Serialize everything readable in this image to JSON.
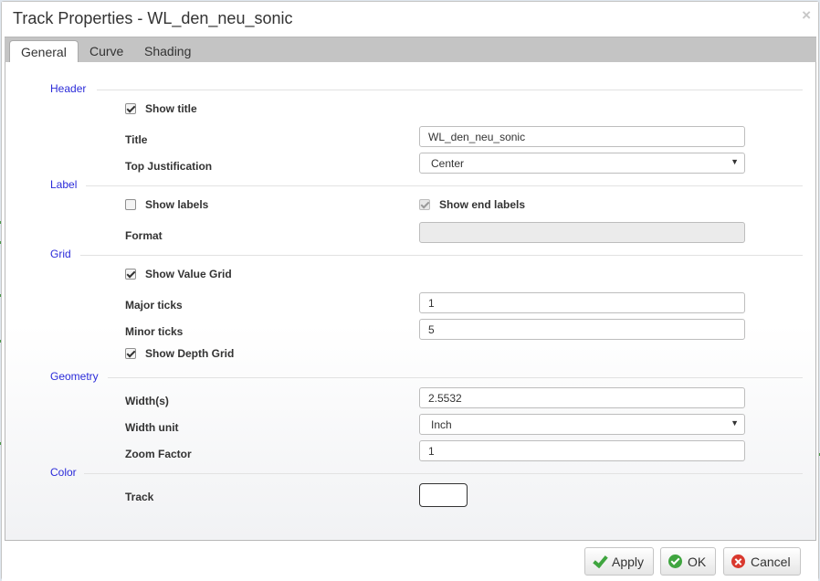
{
  "dialog": {
    "title": "Track Properties - WL_den_neu_sonic",
    "close_glyph": "×"
  },
  "tabs": [
    {
      "label": "General",
      "active": true
    },
    {
      "label": "Curve",
      "active": false
    },
    {
      "label": "Shading",
      "active": false
    }
  ],
  "sections": {
    "header": {
      "label": "Header",
      "show_title": {
        "label": "Show title",
        "checked": true
      },
      "title": {
        "label": "Title",
        "value": "WL_den_neu_sonic"
      },
      "top_justification": {
        "label": "Top Justification",
        "value": "Center"
      }
    },
    "label": {
      "label": "Label",
      "show_labels": {
        "label": "Show labels",
        "checked": false
      },
      "show_end_labels": {
        "label": "Show end labels",
        "checked": true,
        "disabled": true
      },
      "format": {
        "label": "Format",
        "value": ""
      }
    },
    "grid": {
      "label": "Grid",
      "show_value_grid": {
        "label": "Show Value Grid",
        "checked": true
      },
      "major_ticks": {
        "label": "Major ticks",
        "value": "1"
      },
      "minor_ticks": {
        "label": "Minor ticks",
        "value": "5"
      },
      "show_depth_grid": {
        "label": "Show Depth Grid",
        "checked": true
      }
    },
    "geometry": {
      "label": "Geometry",
      "widths": {
        "label": "Width(s)",
        "value": "2.5532"
      },
      "width_unit": {
        "label": "Width unit",
        "value": "Inch"
      },
      "zoom_factor": {
        "label": "Zoom Factor",
        "value": "1"
      }
    },
    "color": {
      "label": "Color",
      "track": {
        "label": "Track",
        "value": "#ffffff"
      }
    }
  },
  "footer": {
    "apply_label": "Apply",
    "ok_label": "OK",
    "cancel_label": "Cancel"
  },
  "colors": {
    "section_label": "#2b2bd9",
    "apply_icon": "#3fa53f",
    "ok_icon": "#3fa53f",
    "cancel_icon": "#d9382e"
  }
}
